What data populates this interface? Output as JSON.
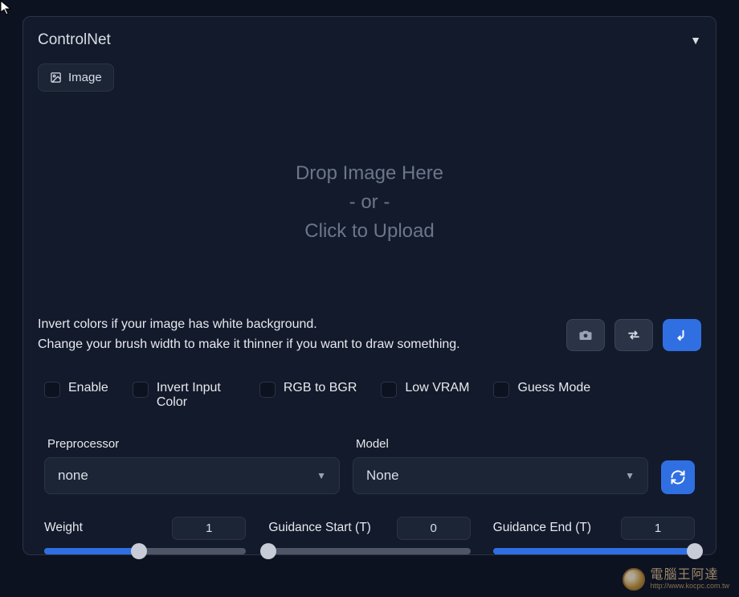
{
  "panel": {
    "title": "ControlNet",
    "tab_label": "Image"
  },
  "dropzone": {
    "line1": "Drop Image Here",
    "line2": "- or -",
    "line3": "Click to Upload"
  },
  "help": {
    "line1": "Invert colors if your image has white background.",
    "line2": "Change your brush width to make it thinner if you want to draw something."
  },
  "icons": {
    "camera": "camera-icon",
    "swap": "swap-icon",
    "arrow": "arrow-return-icon"
  },
  "checkboxes": {
    "enable": "Enable",
    "invert": "Invert Input Color",
    "rgb_bgr": "RGB to BGR",
    "low_vram": "Low VRAM",
    "guess_mode": "Guess Mode"
  },
  "selects": {
    "preprocessor": {
      "label": "Preprocessor",
      "value": "none"
    },
    "model": {
      "label": "Model",
      "value": "None"
    }
  },
  "sliders": {
    "weight": {
      "label": "Weight",
      "value": "1",
      "percent": 47
    },
    "guidance_start": {
      "label": "Guidance Start (T)",
      "value": "0",
      "percent": 0
    },
    "guidance_end": {
      "label": "Guidance End (T)",
      "value": "1",
      "percent": 100
    }
  },
  "watermark": {
    "text": "電腦王阿達",
    "url": "http://www.kocpc.com.tw"
  }
}
